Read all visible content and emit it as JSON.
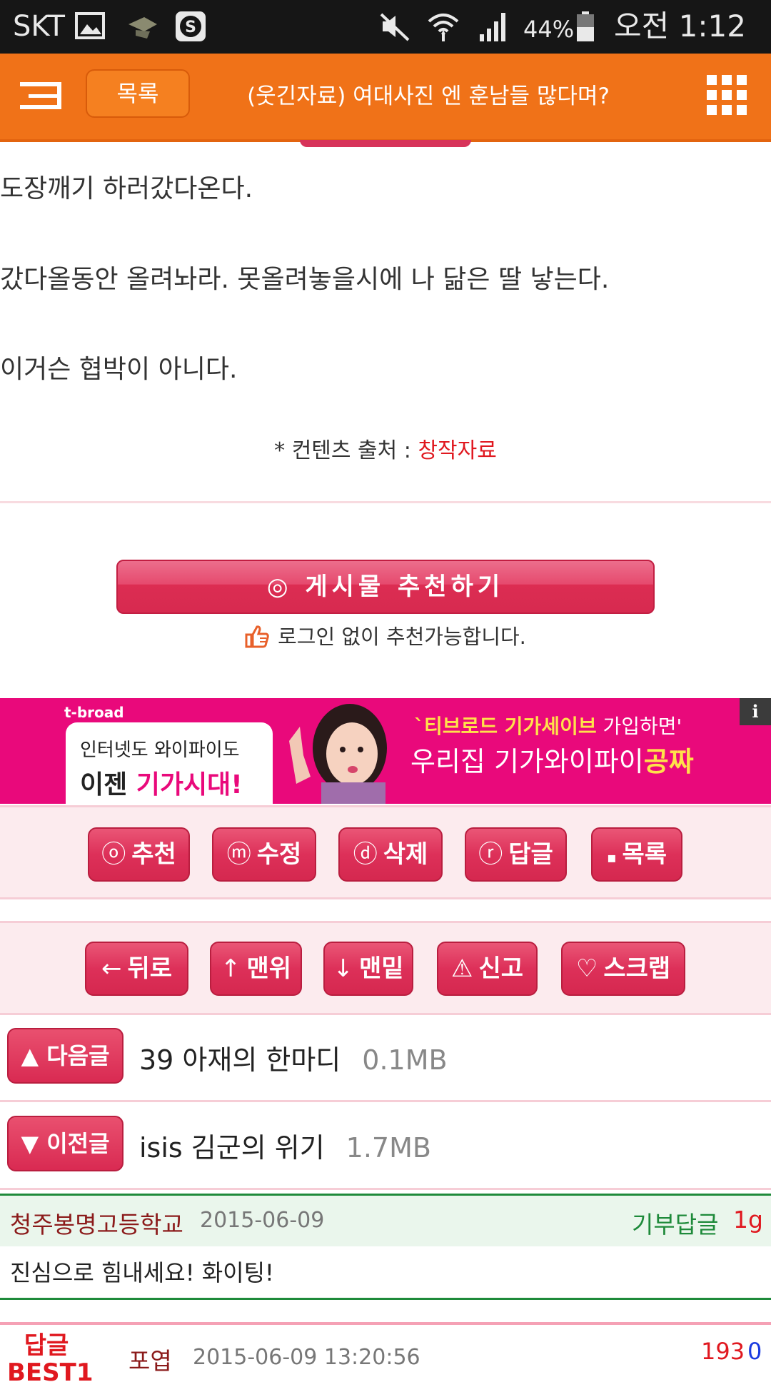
{
  "status_bar": {
    "carrier": "SKT",
    "battery": "44%",
    "time": "오전 1:12"
  },
  "header": {
    "list_button": "목록",
    "title": "(웃긴자료) 여대사진 엔 훈남들 많다며?"
  },
  "article": {
    "lines": [
      "도장깨기 하러갔다온다.",
      "갔다올동안 올려놔라. 못올려놓을시에 나 닮은 딸 낳는다.",
      "이거슨 협박이 아니다."
    ],
    "source_prefix": "* 컨텐츠 출처 : ",
    "source_value": "창작자료"
  },
  "recommend": {
    "button": "◎ 게시물  추천하기",
    "note": "로그인 없이 추천가능합니다."
  },
  "ad": {
    "brand": "t-broad",
    "line1": "인터넷도 와이파이도",
    "line2_a": "이젠 ",
    "line2_b": "기가시대!",
    "head1_a": "`티브로드 기가세이브",
    "head1_b": " 가입하면'",
    "head2_a": "우리집 기가와이파이",
    "head2_b": "공짜",
    "info": "i"
  },
  "actions_row1": [
    {
      "icon": "ⓞ",
      "label": "추천"
    },
    {
      "icon": "ⓜ",
      "label": "수정"
    },
    {
      "icon": "ⓓ",
      "label": "삭제"
    },
    {
      "icon": "ⓡ",
      "label": "답글"
    },
    {
      "icon": "▪",
      "label": "목록"
    }
  ],
  "actions_row2": [
    {
      "icon": "←",
      "label": "뒤로"
    },
    {
      "icon": "↑",
      "label": "맨위"
    },
    {
      "icon": "↓",
      "label": "맨밑"
    },
    {
      "icon": "⚠",
      "label": "신고"
    },
    {
      "icon": "♡",
      "label": "스크랩"
    }
  ],
  "next_post": {
    "button": "▲ 다음글",
    "title": "39 아재의 한마디",
    "size": "0.1MB"
  },
  "prev_post": {
    "button": "▼ 이전글",
    "title": "isis 김군의 위기",
    "size": "1.7MB"
  },
  "comment": {
    "author": "청주봉명고등학교",
    "date": "2015-06-09",
    "label": "기부답글",
    "amount": "1g",
    "text": "진심으로 힘내세요! 화이팅!"
  },
  "best_reply": {
    "label": "답글\nBEST1",
    "author": "포엽",
    "date": "2015-06-09 13:20:56",
    "up": "193",
    "down": "0"
  },
  "colors": {
    "header_orange": "#f07218",
    "button_pink": "#dd3059",
    "ad_pink": "#e9097b",
    "comment_green": "#1e8a3a"
  }
}
